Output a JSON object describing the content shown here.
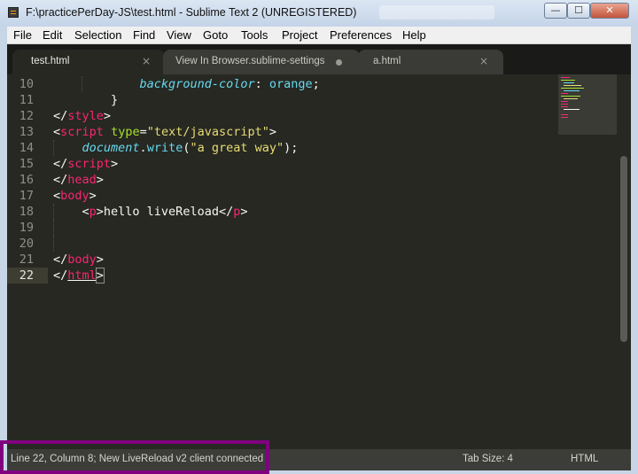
{
  "window": {
    "title": "F:\\practicePerDay-JS\\test.html - Sublime Text 2 (UNREGISTERED)",
    "min_glyph": "—",
    "max_glyph": "☐",
    "close_glyph": "✕"
  },
  "menu": [
    "File",
    "Edit",
    "Selection",
    "Find",
    "View",
    "Goto",
    "Tools",
    "Project",
    "Preferences",
    "Help"
  ],
  "tabs": [
    {
      "label": "test.html",
      "state": "active",
      "close": "×"
    },
    {
      "label": "View In Browser.sublime-settings",
      "state": "modified"
    },
    {
      "label": "a.html",
      "state": "normal",
      "close": "×"
    }
  ],
  "editor": {
    "line_numbers": [
      "10",
      "11",
      "12",
      "13",
      "14",
      "15",
      "16",
      "17",
      "18",
      "19",
      "20",
      "21",
      "22"
    ],
    "current_line": "22",
    "lines": [
      [
        "            ",
        "background-color",
        ": ",
        "orange",
        ";"
      ],
      [
        "        }"
      ],
      [
        "</",
        "style",
        ">"
      ],
      [
        "<",
        "script",
        " ",
        "type",
        "=",
        "\"text/javascript\"",
        ">"
      ],
      [
        "    ",
        "document",
        ".",
        "write",
        "(",
        "\"a great way\"",
        ");"
      ],
      [
        "</",
        "script",
        ">"
      ],
      [
        "</",
        "head",
        ">"
      ],
      [
        "<",
        "body",
        ">"
      ],
      [
        "    <",
        "p",
        ">hello liveReload</",
        "p",
        ">"
      ],
      [
        ""
      ],
      [
        ""
      ],
      [
        "</",
        "body",
        ">"
      ],
      [
        "</",
        "html",
        ">"
      ]
    ]
  },
  "status": {
    "message": "Line 22, Column 8; New LiveReload v2 client connected",
    "tab_size": "Tab Size: 4",
    "syntax": "HTML"
  },
  "colors": {
    "background": "#272822",
    "tag": "#f92672",
    "attribute": "#a6e22e",
    "string": "#e6db74",
    "keyword": "#66d9ef",
    "highlight_box": "#800080"
  }
}
